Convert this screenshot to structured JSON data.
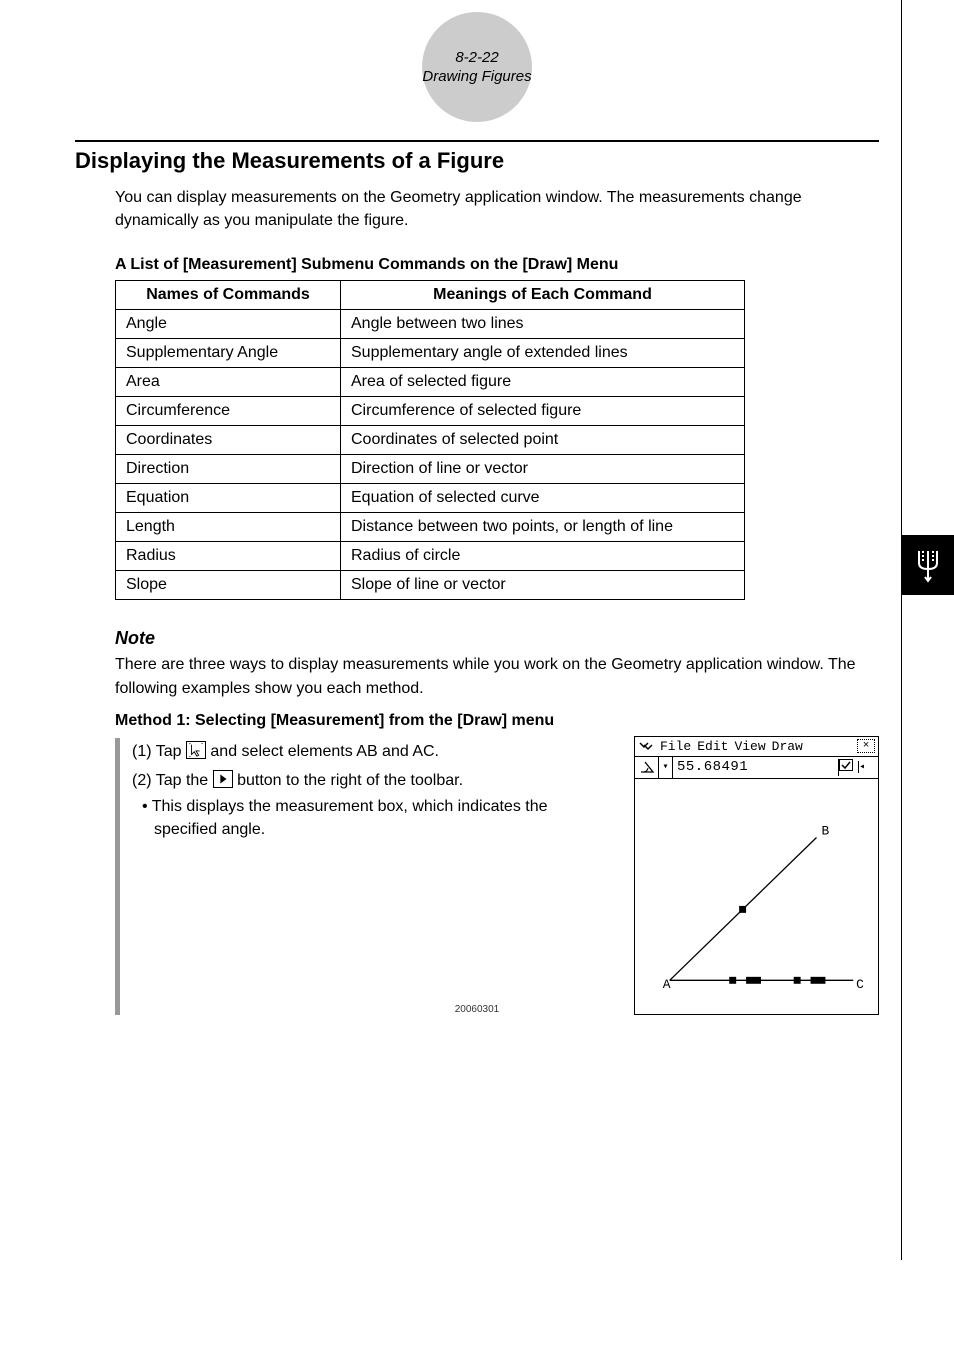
{
  "header": {
    "page_ref": "8-2-22",
    "chapter": "Drawing Figures"
  },
  "section": {
    "title": "Displaying the Measurements of a Figure",
    "intro": "You can display measurements on the Geometry application window. The measurements change dynamically as you manipulate the figure."
  },
  "table": {
    "caption": "A List of [Measurement] Submenu Commands on the [Draw] Menu",
    "head_left": "Names of Commands",
    "head_right": "Meanings of Each Command",
    "rows": [
      {
        "name": "Angle",
        "meaning": "Angle between two lines"
      },
      {
        "name": "Supplementary Angle",
        "meaning": "Supplementary angle of extended lines"
      },
      {
        "name": "Area",
        "meaning": "Area of selected figure"
      },
      {
        "name": "Circumference",
        "meaning": "Circumference of selected figure"
      },
      {
        "name": "Coordinates",
        "meaning": "Coordinates of selected point"
      },
      {
        "name": "Direction",
        "meaning": "Direction of line or vector"
      },
      {
        "name": "Equation",
        "meaning": "Equation of selected curve"
      },
      {
        "name": "Length",
        "meaning": "Distance between two points, or length of line"
      },
      {
        "name": "Radius",
        "meaning": "Radius of circle"
      },
      {
        "name": "Slope",
        "meaning": "Slope of line or vector"
      }
    ]
  },
  "note": {
    "head": "Note",
    "body": "There are three ways to display measurements while you work on the Geometry application window. The following examples show you each method."
  },
  "method1": {
    "head": "Method 1:  Selecting [Measurement] from the [Draw] menu",
    "step1_a": "(1) Tap ",
    "step1_b": " and select elements AB and AC.",
    "step2_a": "(2) Tap the ",
    "step2_b": " button to the right of the toolbar.",
    "bullet": "• This displays the measurement box, which indicates the specified angle."
  },
  "screenshot": {
    "menus": {
      "file": "File",
      "edit": "Edit",
      "view": "View",
      "draw": "Draw"
    },
    "measure_value": "55.68491",
    "points": {
      "a": "A",
      "b": "B",
      "c": "C"
    }
  },
  "footer": "20060301"
}
